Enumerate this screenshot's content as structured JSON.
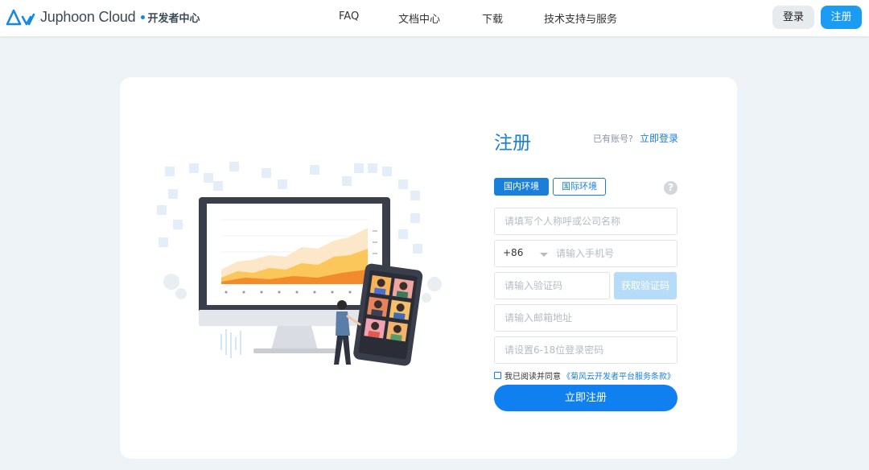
{
  "header": {
    "brand": "Juphoon Cloud",
    "brand_sub": "开发者中心",
    "nav": [
      "FAQ",
      "文档中心",
      "下载",
      "技术支持与服务"
    ],
    "login_label": "登录",
    "register_label": "注册"
  },
  "form": {
    "title": "注册",
    "have_account": "已有账号?",
    "login_link": "立即登录",
    "env_tabs": [
      "国内环境",
      "国际环境"
    ],
    "help": "?",
    "name_placeholder": "请填写个人称呼或公司名称",
    "phone_code": "+86",
    "phone_placeholder": "请输入手机号",
    "code_placeholder": "请输入验证码",
    "get_code_label": "获取验证码",
    "email_placeholder": "请输入邮箱地址",
    "password_placeholder": "请设置6-18位登录密码",
    "agree_text": "我已阅读并同意",
    "agree_link": "《菊风云开发者平台服务条款》",
    "submit_label": "立即注册"
  },
  "colors": {
    "primary": "#1080f0",
    "accent": "#1a7fd9",
    "disabled_button": "#b6dcf9",
    "page_bg": "#eef3f7"
  }
}
